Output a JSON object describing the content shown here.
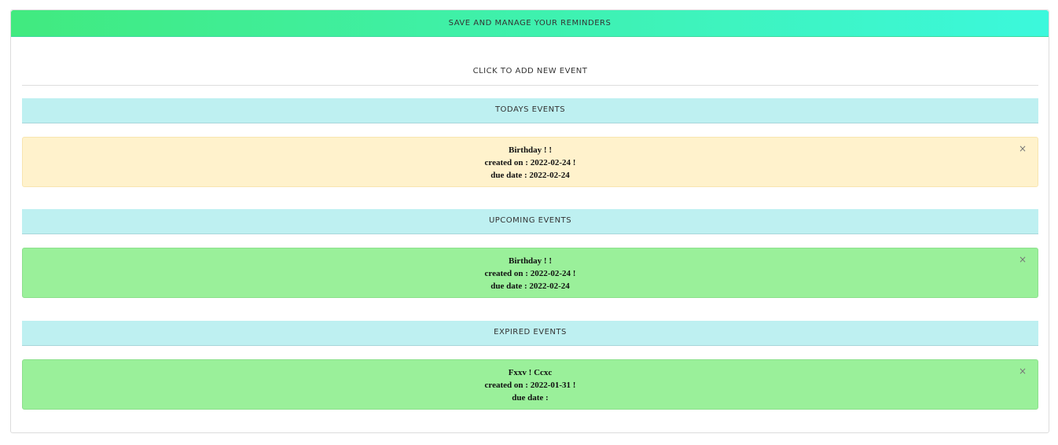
{
  "header": {
    "title": "SAVE AND MANAGE YOUR REMINDERS"
  },
  "add_button": "CLICK TO ADD NEW EVENT",
  "sections": [
    {
      "title": "TODAYS EVENTS",
      "events": [
        {
          "title": "Birthday ! !",
          "created": "created on : 2022-02-24 !",
          "due": "due date : 2022-02-24",
          "color": "#fff2cc"
        }
      ]
    },
    {
      "title": "UPCOMING EVENTS",
      "events": [
        {
          "title": "Birthday ! !",
          "created": "created on : 2022-02-24 !",
          "due": "due date : 2022-02-24",
          "color": "#9af09a"
        }
      ]
    },
    {
      "title": "EXPIRED EVENTS",
      "events": [
        {
          "title": "Fxxv ! Ccxc",
          "created": "created on : 2022-01-31 !",
          "due": "due date :",
          "color": "#9af09a"
        }
      ]
    }
  ],
  "close_icon": "×"
}
